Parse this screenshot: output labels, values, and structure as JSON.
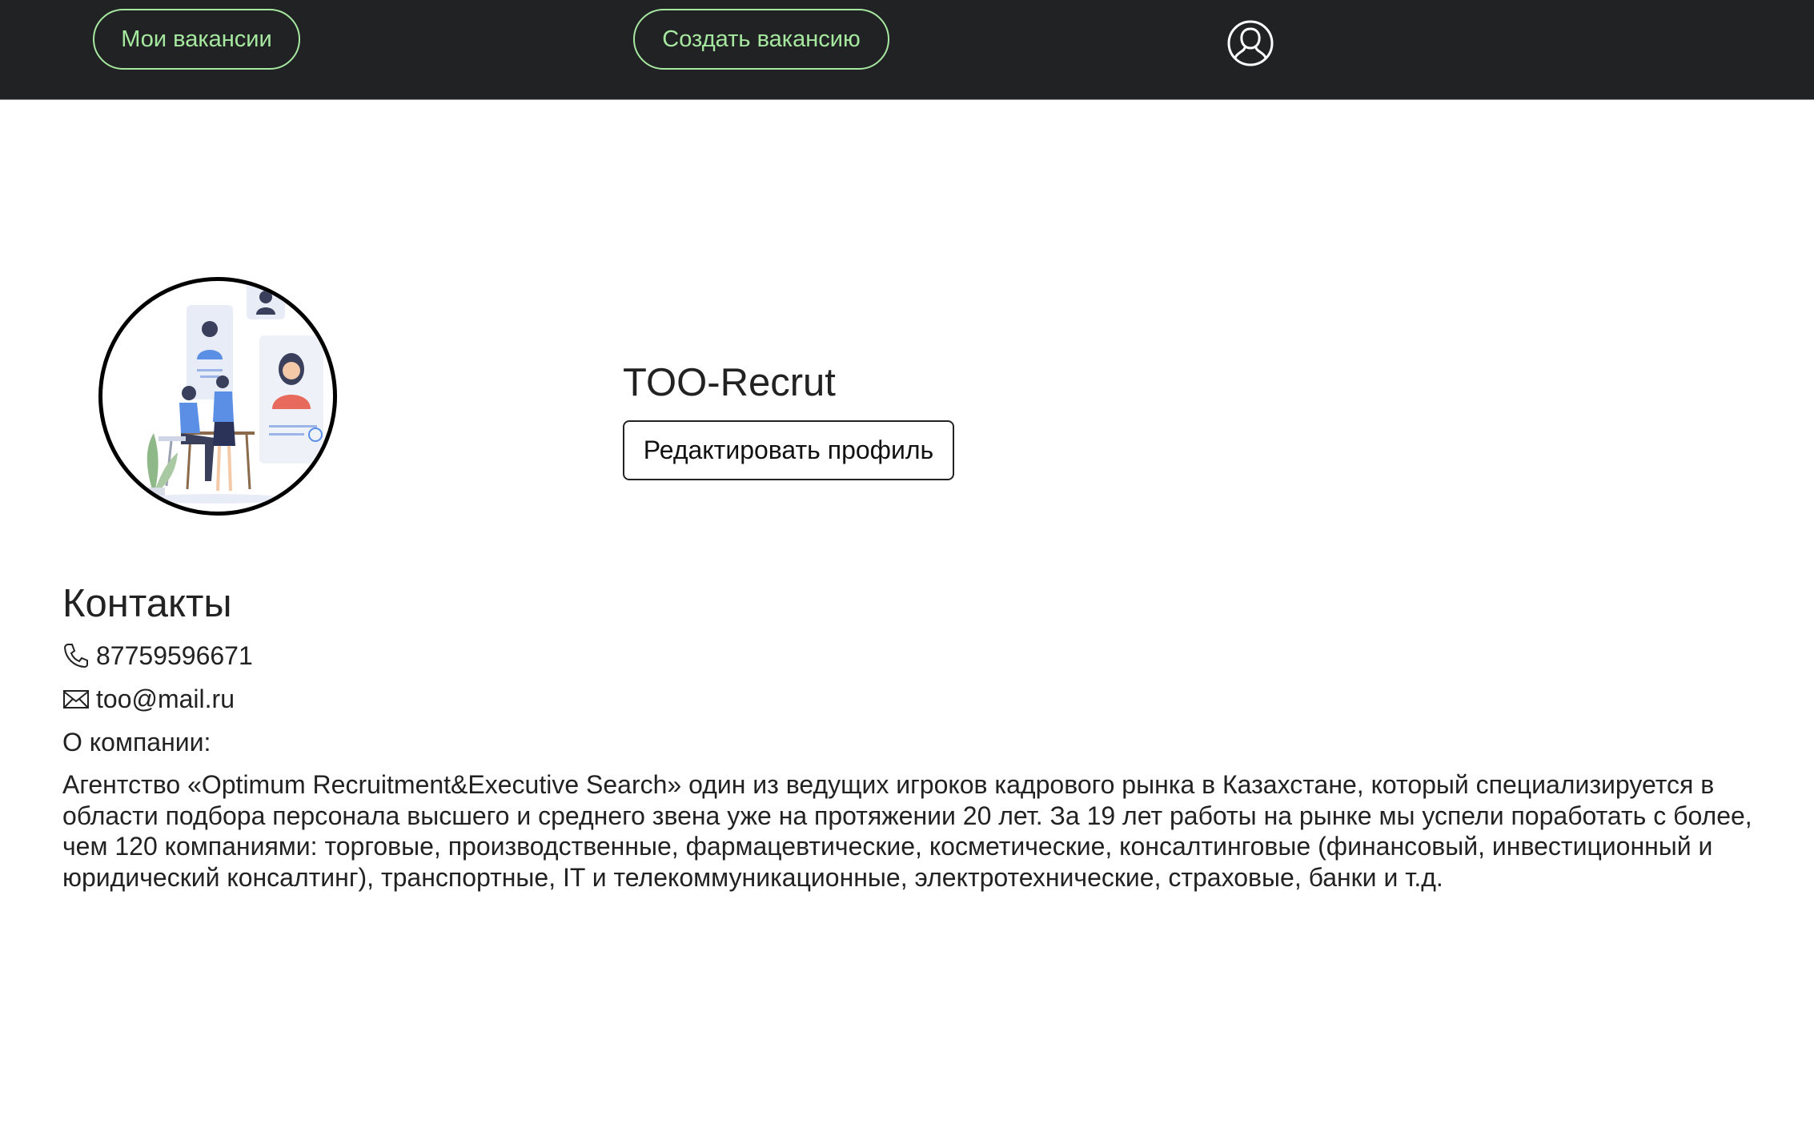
{
  "nav": {
    "my_vacancies_label": "Мои вакансии",
    "create_vacancy_label": "Создать вакансию",
    "profile_icon": "user-icon"
  },
  "profile": {
    "company_name": "TOO-Recrut",
    "edit_button_label": "Редактировать профиль"
  },
  "contacts": {
    "title": "Контакты",
    "phone": "87759596671",
    "email": "too@mail.ru",
    "about_label": "О компании:",
    "about_text": "Агентство «Optimum Recruitment&Executive Search» один из ведущих игроков кадрового рынка в Казахстане, который специализируется в области подбора персонала высшего и среднего звена уже на протяжении 20 лет. За 19 лет работы на рынке мы успели поработать с более, чем 120 компаниями: торговые, производственные, фармацевтические, косметические, консалтинговые (финансовый, инвестиционный и юридический консалтинг), транспортные, IT и телекоммуникационные, электротехнические, страховые, банки и т.д."
  },
  "colors": {
    "topbar_bg": "#212223",
    "nav_accent": "#a6e8a0",
    "text": "#222222"
  }
}
